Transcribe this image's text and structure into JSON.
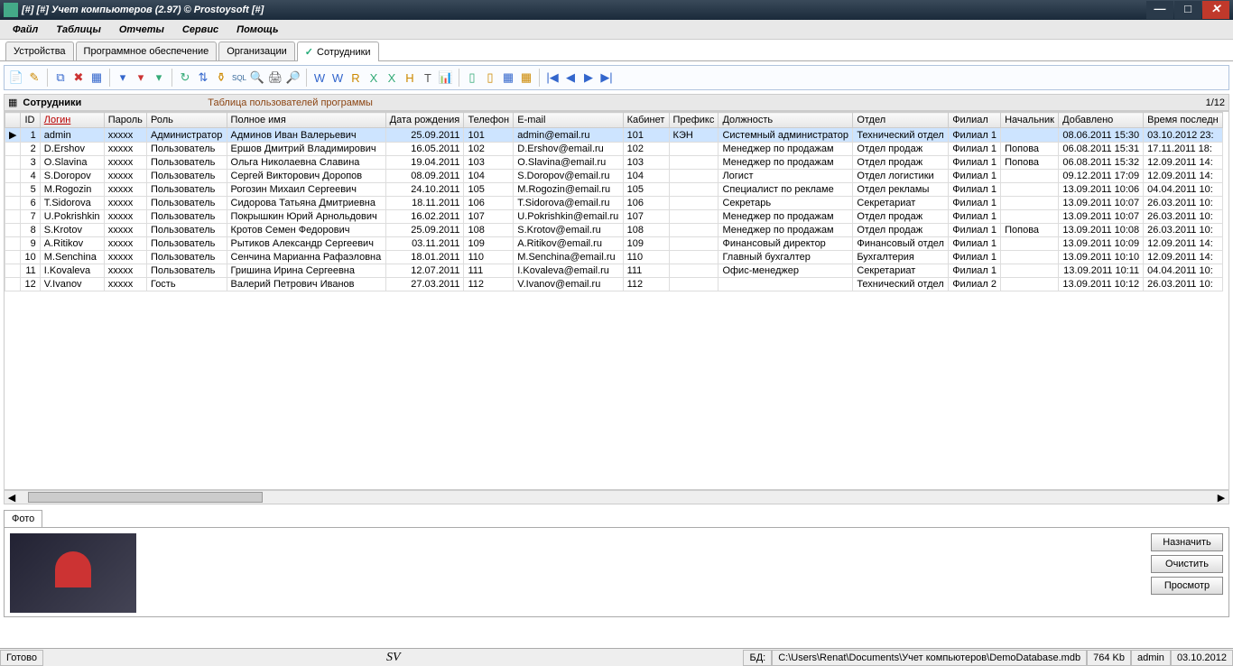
{
  "window": {
    "title": "[#] [#] Учет компьютеров (2.97) © Prostoysoft [#]"
  },
  "menu": [
    "Файл",
    "Таблицы",
    "Отчеты",
    "Сервис",
    "Помощь"
  ],
  "tabs": [
    {
      "label": "Устройства",
      "active": false
    },
    {
      "label": "Программное обеспечение",
      "active": false
    },
    {
      "label": "Организации",
      "active": false
    },
    {
      "label": "Сотрудники",
      "active": true,
      "check": true
    }
  ],
  "table": {
    "title": "Сотрудники",
    "description": "Таблица пользователей программы",
    "counter": "1/12",
    "columns": [
      "",
      "ID",
      "Логин",
      "Пароль",
      "Роль",
      "Полное имя",
      "Дата рождения",
      "Телефон",
      "E-mail",
      "Кабинет",
      "Префикс",
      "Должность",
      "Отдел",
      "Филиал",
      "Начальник",
      "Добавлено",
      "Время последн"
    ],
    "rows": [
      {
        "sel": true,
        "id": "1",
        "login": "admin",
        "pwd": "xxxxx",
        "role": "Администратор",
        "fullname": "Админов Иван Валерьевич",
        "dob": "25.09.2011",
        "phone": "101",
        "email": "admin@email.ru",
        "room": "101",
        "prefix": "КЭН",
        "position": "Системный администратор",
        "dept": "Технический отдел",
        "branch": "Филиал 1",
        "boss": "",
        "added": "08.06.2011 15:30",
        "last": "03.10.2012 23:"
      },
      {
        "id": "2",
        "login": "D.Ershov",
        "pwd": "xxxxx",
        "role": "Пользователь",
        "fullname": "Ершов Дмитрий Владимирович",
        "dob": "16.05.2011",
        "phone": "102",
        "email": "D.Ershov@email.ru",
        "room": "102",
        "prefix": "",
        "position": "Менеджер по продажам",
        "dept": "Отдел продаж",
        "branch": "Филиал 1",
        "boss": "Попова",
        "added": "06.08.2011 15:31",
        "last": "17.11.2011 18:"
      },
      {
        "id": "3",
        "login": "O.Slavina",
        "pwd": "xxxxx",
        "role": "Пользователь",
        "fullname": "Ольга Николаевна Славина",
        "dob": "19.04.2011",
        "phone": "103",
        "email": "O.Slavina@email.ru",
        "room": "103",
        "prefix": "",
        "position": "Менеджер по продажам",
        "dept": "Отдел продаж",
        "branch": "Филиал 1",
        "boss": "Попова",
        "added": "06.08.2011 15:32",
        "last": "12.09.2011 14:"
      },
      {
        "id": "4",
        "login": "S.Doropov",
        "pwd": "xxxxx",
        "role": "Пользователь",
        "fullname": "Сергей Викторович Доропов",
        "dob": "08.09.2011",
        "phone": "104",
        "email": "S.Doropov@email.ru",
        "room": "104",
        "prefix": "",
        "position": "Логист",
        "dept": "Отдел логистики",
        "branch": "Филиал 1",
        "boss": "",
        "added": "09.12.2011 17:09",
        "last": "12.09.2011 14:"
      },
      {
        "id": "5",
        "login": "M.Rogozin",
        "pwd": "xxxxx",
        "role": "Пользователь",
        "fullname": "Рогозин Михаил Сергеевич",
        "dob": "24.10.2011",
        "phone": "105",
        "email": "M.Rogozin@email.ru",
        "room": "105",
        "prefix": "",
        "position": "Специалист по рекламе",
        "dept": "Отдел рекламы",
        "branch": "Филиал 1",
        "boss": "",
        "added": "13.09.2011 10:06",
        "last": "04.04.2011 10:"
      },
      {
        "id": "6",
        "login": "T.Sidorova",
        "pwd": "xxxxx",
        "role": "Пользователь",
        "fullname": "Сидорова Татьяна Дмитриевна",
        "dob": "18.11.2011",
        "phone": "106",
        "email": "T.Sidorova@email.ru",
        "room": "106",
        "prefix": "",
        "position": "Секретарь",
        "dept": "Секретариат",
        "branch": "Филиал 1",
        "boss": "",
        "added": "13.09.2011 10:07",
        "last": "26.03.2011 10:"
      },
      {
        "id": "7",
        "login": "U.Pokrishkin",
        "pwd": "xxxxx",
        "role": "Пользователь",
        "fullname": "Покрышкин Юрий Арнольдович",
        "dob": "16.02.2011",
        "phone": "107",
        "email": "U.Pokrishkin@email.ru",
        "room": "107",
        "prefix": "",
        "position": "Менеджер по продажам",
        "dept": "Отдел продаж",
        "branch": "Филиал 1",
        "boss": "",
        "added": "13.09.2011 10:07",
        "last": "26.03.2011 10:"
      },
      {
        "id": "8",
        "login": "S.Krotov",
        "pwd": "xxxxx",
        "role": "Пользователь",
        "fullname": "Кротов Семен Федорович",
        "dob": "25.09.2011",
        "phone": "108",
        "email": "S.Krotov@email.ru",
        "room": "108",
        "prefix": "",
        "position": "Менеджер по продажам",
        "dept": "Отдел продаж",
        "branch": "Филиал 1",
        "boss": "Попова",
        "added": "13.09.2011 10:08",
        "last": "26.03.2011 10:"
      },
      {
        "id": "9",
        "login": "A.Ritikov",
        "pwd": "xxxxx",
        "role": "Пользователь",
        "fullname": "Рытиков Александр Сергеевич",
        "dob": "03.11.2011",
        "phone": "109",
        "email": "A.Ritikov@email.ru",
        "room": "109",
        "prefix": "",
        "position": "Финансовый директор",
        "dept": "Финансовый отдел",
        "branch": "Филиал 1",
        "boss": "",
        "added": "13.09.2011 10:09",
        "last": "12.09.2011 14:"
      },
      {
        "id": "10",
        "login": "M.Senchina",
        "pwd": "xxxxx",
        "role": "Пользователь",
        "fullname": "Сенчина Марианна Рафаэловна",
        "dob": "18.01.2011",
        "phone": "110",
        "email": "M.Senchina@email.ru",
        "room": "110",
        "prefix": "",
        "position": "Главный бухгалтер",
        "dept": "Бухгалтерия",
        "branch": "Филиал 1",
        "boss": "",
        "added": "13.09.2011 10:10",
        "last": "12.09.2011 14:"
      },
      {
        "id": "11",
        "login": "I.Kovaleva",
        "pwd": "xxxxx",
        "role": "Пользователь",
        "fullname": "Гришина Ирина Сергеевна",
        "dob": "12.07.2011",
        "phone": "111",
        "email": "I.Kovaleva@email.ru",
        "room": "111",
        "prefix": "",
        "position": "Офис-менеджер",
        "dept": "Секретариат",
        "branch": "Филиал 1",
        "boss": "",
        "added": "13.09.2011 10:11",
        "last": "04.04.2011 10:"
      },
      {
        "id": "12",
        "login": "V.Ivanov",
        "pwd": "xxxxx",
        "role": "Гость",
        "fullname": "Валерий Петрович Иванов",
        "dob": "27.03.2011",
        "phone": "112",
        "email": "V.Ivanov@email.ru",
        "room": "112",
        "prefix": "",
        "position": "",
        "dept": "Технический отдел",
        "branch": "Филиал 2",
        "boss": "",
        "added": "13.09.2011 10:12",
        "last": "26.03.2011 10:"
      }
    ]
  },
  "photo": {
    "tab_label": "Фото",
    "btn_assign": "Назначить",
    "btn_clear": "Очистить",
    "btn_view": "Просмотр"
  },
  "status": {
    "ready": "Готово",
    "logo": "SV",
    "db_label": "БД:",
    "db_path": "C:\\Users\\Renat\\Documents\\Учет компьютеров\\DemoDatabase.mdb",
    "size": "764 Kb",
    "user": "admin",
    "date": "03.10.2012"
  },
  "toolbar_icons": [
    {
      "name": "new-icon",
      "glyph": "📄",
      "c": "#3a7"
    },
    {
      "name": "edit-icon",
      "glyph": "✎",
      "c": "#c80"
    },
    {
      "sep": true
    },
    {
      "name": "copy-icon",
      "glyph": "⧉",
      "c": "#36c"
    },
    {
      "name": "delete-icon",
      "glyph": "✖",
      "c": "#c33"
    },
    {
      "name": "table-icon",
      "glyph": "▦",
      "c": "#36c"
    },
    {
      "sep": true
    },
    {
      "name": "filter-icon",
      "glyph": "▾",
      "c": "#36c"
    },
    {
      "name": "filter-clear-icon",
      "glyph": "▾",
      "c": "#c33"
    },
    {
      "name": "filter-add-icon",
      "glyph": "▾",
      "c": "#3a7"
    },
    {
      "sep": true
    },
    {
      "name": "refresh-icon",
      "glyph": "↻",
      "c": "#3a7"
    },
    {
      "name": "sort-icon",
      "glyph": "⇅",
      "c": "#36c"
    },
    {
      "name": "group-icon",
      "glyph": "⚱",
      "c": "#c80"
    },
    {
      "name": "sql-icon",
      "glyph": "SQL",
      "c": "#369",
      "fs": "8px"
    },
    {
      "name": "search-icon",
      "glyph": "🔍",
      "c": "#333"
    },
    {
      "name": "print-icon",
      "glyph": "🖨",
      "c": "#555"
    },
    {
      "name": "preview-icon",
      "glyph": "🔎",
      "c": "#555"
    },
    {
      "sep": true
    },
    {
      "name": "export-word-icon",
      "glyph": "W",
      "c": "#36c"
    },
    {
      "name": "export-word2-icon",
      "glyph": "W",
      "c": "#36c"
    },
    {
      "name": "export-rtf-icon",
      "glyph": "R",
      "c": "#c80"
    },
    {
      "name": "export-excel-icon",
      "glyph": "X",
      "c": "#3a7"
    },
    {
      "name": "export-excel2-icon",
      "glyph": "X",
      "c": "#3a7"
    },
    {
      "name": "export-html-icon",
      "glyph": "H",
      "c": "#c80"
    },
    {
      "name": "export-txt-icon",
      "glyph": "T",
      "c": "#555"
    },
    {
      "name": "chart-icon",
      "glyph": "📊",
      "c": "#36c"
    },
    {
      "sep": true
    },
    {
      "name": "col-add-icon",
      "glyph": "▯",
      "c": "#3a7"
    },
    {
      "name": "col-del-icon",
      "glyph": "▯",
      "c": "#c80"
    },
    {
      "name": "col-cfg-icon",
      "glyph": "▦",
      "c": "#36c"
    },
    {
      "name": "col-cfg2-icon",
      "glyph": "▦",
      "c": "#c80"
    },
    {
      "sep": true
    },
    {
      "name": "nav-first-icon",
      "glyph": "|◀",
      "c": "#36c"
    },
    {
      "name": "nav-prev-icon",
      "glyph": "◀",
      "c": "#36c"
    },
    {
      "name": "nav-next-icon",
      "glyph": "▶",
      "c": "#36c"
    },
    {
      "name": "nav-last-icon",
      "glyph": "▶|",
      "c": "#36c"
    }
  ]
}
